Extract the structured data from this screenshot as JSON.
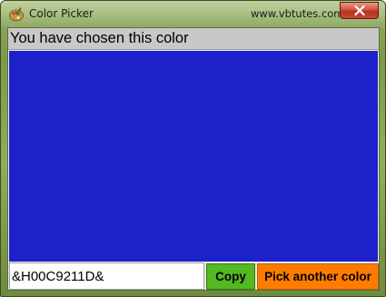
{
  "window": {
    "title": "Color Picker",
    "site": "www.vbtutes.com",
    "close_icon": "close-x-icon",
    "app_icon": "palette-icon"
  },
  "main": {
    "heading": "You have chosen this color",
    "selected_color_hex": "#1D21C9",
    "color_code": "&H00C9211D&",
    "copy_label": "Copy",
    "pick_label": "Pick another color"
  },
  "colors": {
    "copy_button": "#54B821",
    "pick_button": "#FF7C00",
    "heading_background": "#C8C8C8"
  }
}
